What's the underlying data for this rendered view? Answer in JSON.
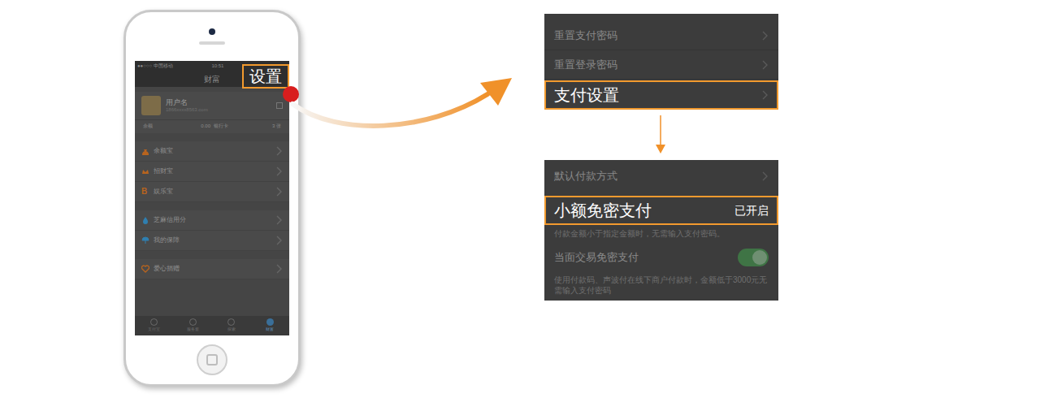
{
  "phone": {
    "status_bar": {
      "carrier": "●●○○○ 中国移动",
      "time": "10:51"
    },
    "title": "财富",
    "user": {
      "name": "用户名",
      "account": "1866xxxx8563.com"
    },
    "stats": [
      {
        "label": "余额",
        "value": "0.00"
      },
      {
        "label": "银行卡",
        "value": "3 张"
      }
    ],
    "menu_groups": [
      {
        "items": [
          {
            "label": "余额宝",
            "kind": "bag",
            "color": "#b8641e"
          },
          {
            "label": "招财宝",
            "kind": "crown",
            "color": "#b8641e"
          },
          {
            "label": "娱乐宝",
            "kind": "letter",
            "glyph": "B",
            "color": "#b8641e"
          }
        ]
      },
      {
        "items": [
          {
            "label": "芝麻信用分",
            "kind": "drop",
            "color": "#2f7fb0"
          },
          {
            "label": "我的保障",
            "kind": "umbrella",
            "color": "#2f7fb0"
          }
        ]
      },
      {
        "items": [
          {
            "label": "爱心捐赠",
            "kind": "heart",
            "color": "#b8641e"
          }
        ]
      }
    ],
    "tabs": [
      {
        "label": "支付宝",
        "selected": false
      },
      {
        "label": "服务窗",
        "selected": false
      },
      {
        "label": "探索",
        "selected": false
      },
      {
        "label": "财富",
        "selected": true
      }
    ],
    "callout": "设置"
  },
  "settings_panel": {
    "rows": [
      {
        "label": "重置支付密码",
        "highlighted": false
      },
      {
        "label": "重置登录密码",
        "highlighted": false
      },
      {
        "label": "支付设置",
        "highlighted": true
      }
    ]
  },
  "payment_panel": {
    "rows": [
      {
        "kind": "link",
        "label": "默认付款方式",
        "highlighted": false
      },
      {
        "kind": "value",
        "label": "小额免密支付",
        "value": "已开启",
        "highlighted": true
      },
      {
        "kind": "note",
        "label": "付款金额小于指定金额时，无需输入支付密码。"
      },
      {
        "kind": "toggle",
        "label": "当面交易免密支付",
        "on": true
      },
      {
        "kind": "note",
        "label": "使用付款码、声波付在线下商户付款时，金额低于3000元无需输入支付密码"
      }
    ]
  }
}
